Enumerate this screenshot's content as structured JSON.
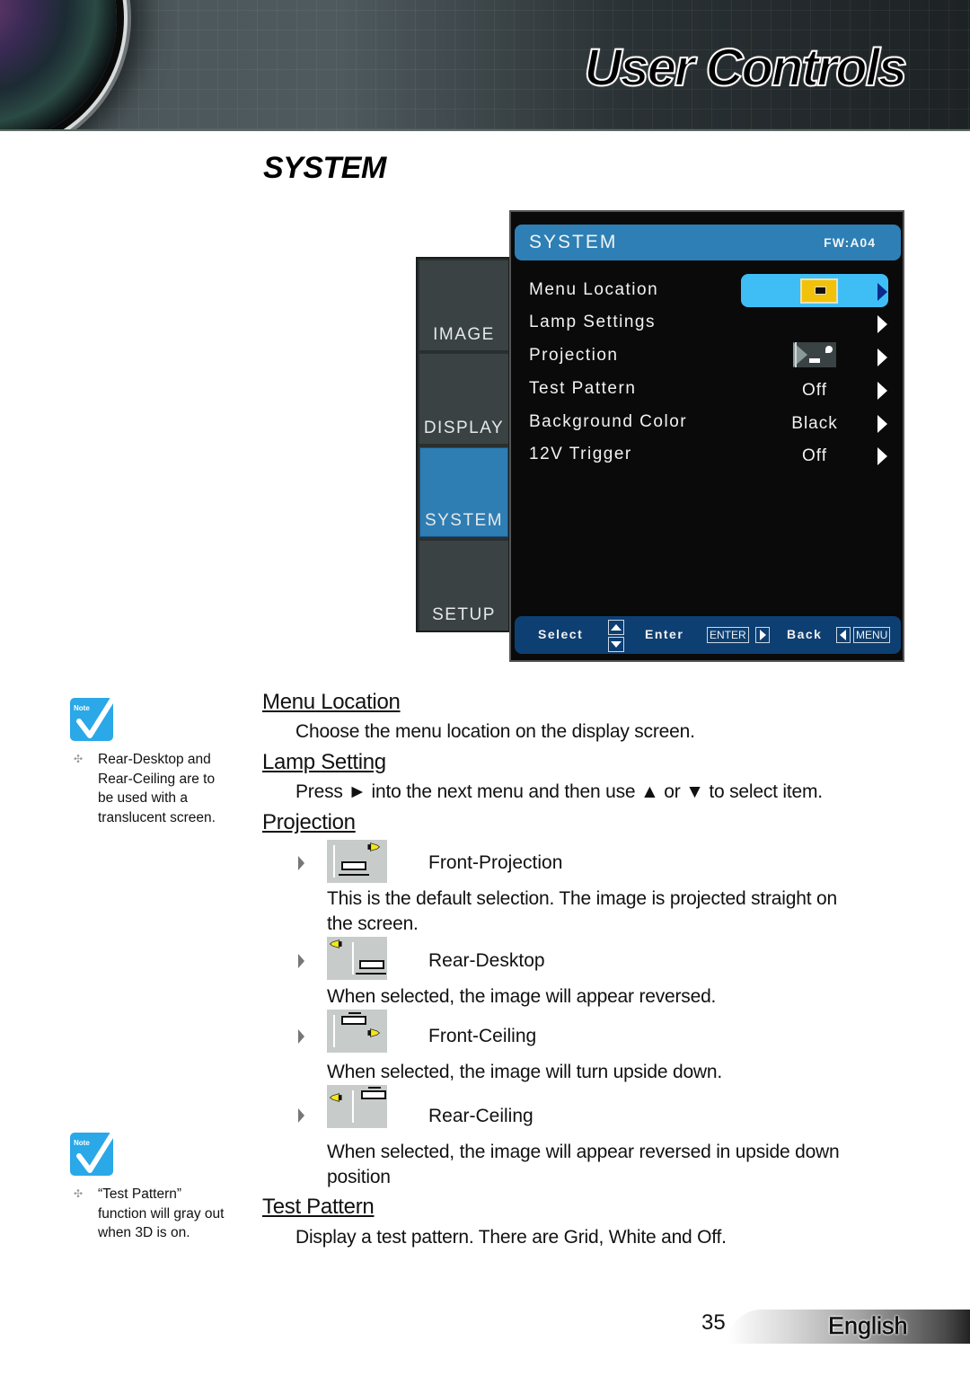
{
  "header": {
    "title": "User Controls"
  },
  "section_title": "SYSTEM",
  "osd": {
    "tabs": [
      {
        "label": "IMAGE",
        "active": false
      },
      {
        "label": "DISPLAY",
        "active": false
      },
      {
        "label": "SYSTEM",
        "active": true
      },
      {
        "label": "SETUP",
        "active": false
      }
    ],
    "title": "SYSTEM",
    "firmware": "FW:A04",
    "rows": [
      {
        "label": "Menu Location",
        "value": "",
        "value_icon": "menu-location-center-icon",
        "selected": true
      },
      {
        "label": "Lamp Settings",
        "value": "",
        "selected": false
      },
      {
        "label": "Projection",
        "value": "",
        "value_icon": "front-projection-icon",
        "selected": false
      },
      {
        "label": "Test Pattern",
        "value": "Off",
        "selected": false
      },
      {
        "label": "Background Color",
        "value": "Black",
        "selected": false
      },
      {
        "label": "12V Trigger",
        "value": "Off",
        "selected": false
      }
    ],
    "footer": {
      "select": "Select",
      "enter": "Enter",
      "enter_key": "ENTER",
      "back": "Back",
      "menu_key": "MENU"
    },
    "colors": {
      "header": "#2d7fb5",
      "highlight": "#3fbef5",
      "footer": "#0d3f72",
      "active_tab": "#2e7db3"
    }
  },
  "notes": [
    {
      "label": "Note",
      "text": "Rear-Desktop and Rear-Ceiling are to be used with a translucent screen."
    },
    {
      "label": "Note",
      "text": "“Test Pattern” function will gray out when 3D is on."
    }
  ],
  "sections": {
    "menu_location": {
      "title": "Menu Location",
      "desc": "Choose the menu location on the display screen."
    },
    "lamp_setting": {
      "title": "Lamp Setting",
      "desc": "Press ► into the next menu and then use ▲ or ▼ to select item."
    },
    "projection": {
      "title": "Projection",
      "modes": [
        {
          "label": "Front-Projection",
          "desc_line1": "This is the default selection. The image is projected straight on",
          "desc_line2": "the screen."
        },
        {
          "label": "Rear-Desktop",
          "desc_line1": "When selected, the image will appear reversed.",
          "desc_line2": ""
        },
        {
          "label": "Front-Ceiling",
          "desc_line1": "When selected, the image will turn upside down.",
          "desc_line2": ""
        },
        {
          "label": "Rear-Ceiling",
          "desc_line1": "When selected, the image will appear reversed in upside down",
          "desc_line2": "position"
        }
      ]
    },
    "test_pattern": {
      "title": "Test Pattern",
      "desc": "Display a test pattern. There are Grid, White and Off."
    }
  },
  "footer": {
    "page_number": "35",
    "language": "English"
  }
}
